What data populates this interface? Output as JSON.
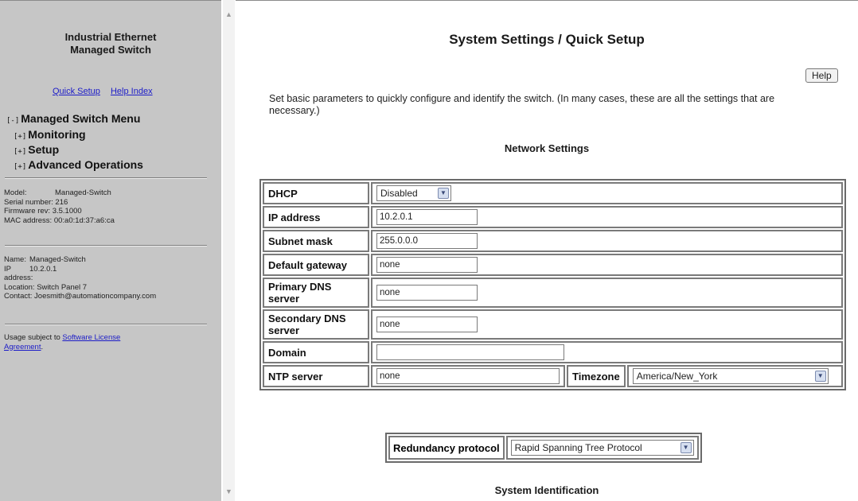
{
  "sidebar": {
    "title_line1": "Industrial Ethernet",
    "title_line2": "Managed Switch",
    "links": {
      "quick_setup": "Quick Setup",
      "help_index": "Help Index"
    },
    "menu": {
      "root_toggle": "[-]",
      "root_label": "Managed Switch Menu",
      "items": [
        {
          "toggle": "[+]",
          "label": "Monitoring"
        },
        {
          "toggle": "[+]",
          "label": "Setup"
        },
        {
          "toggle": "[+]",
          "label": "Advanced Operations"
        }
      ]
    },
    "device_info": {
      "model_label": "Model:",
      "model": "Managed-Switch",
      "serial_label": "Serial number:",
      "serial": "216",
      "firmware_label": "Firmware rev:",
      "firmware": "3.5.1000",
      "mac_label": "MAC address:",
      "mac": "00:a0:1d:37:a6:ca"
    },
    "identity": {
      "name_label": "Name:",
      "name": "Managed-Switch",
      "ip_label_1": "IP",
      "ip_label_2": "address:",
      "ip": "10.2.0.1",
      "location_label": "Location:",
      "location": "Switch Panel 7",
      "contact_label": "Contact:",
      "contact": "Joesmith@automationcompany.com"
    },
    "license": {
      "prefix": "Usage subject to ",
      "link1": "Software License",
      "link2": "Agreement",
      "suffix": "."
    }
  },
  "main": {
    "title": "System Settings / Quick Setup",
    "help_button": "Help",
    "intro": "Set basic parameters to quickly configure and identify the switch. (In many cases, these are all the settings that are necessary.)",
    "network_heading": "Network Settings",
    "fields": {
      "dhcp": {
        "label": "DHCP",
        "value": "Disabled"
      },
      "ip": {
        "label": "IP address",
        "value": "10.2.0.1"
      },
      "subnet": {
        "label": "Subnet mask",
        "value": "255.0.0.0"
      },
      "gateway": {
        "label": "Default gateway",
        "value": "none"
      },
      "dns1": {
        "label": "Primary DNS server",
        "value": "none"
      },
      "dns2": {
        "label": "Secondary DNS server",
        "value": "none"
      },
      "domain": {
        "label": "Domain",
        "value": ""
      },
      "ntp": {
        "label": "NTP server",
        "value": "none"
      },
      "timezone": {
        "label": "Timezone",
        "value": "America/New_York"
      }
    },
    "redundancy": {
      "label": "Redundancy protocol",
      "value": "Rapid Spanning Tree Protocol"
    },
    "identification_heading": "System Identification"
  }
}
